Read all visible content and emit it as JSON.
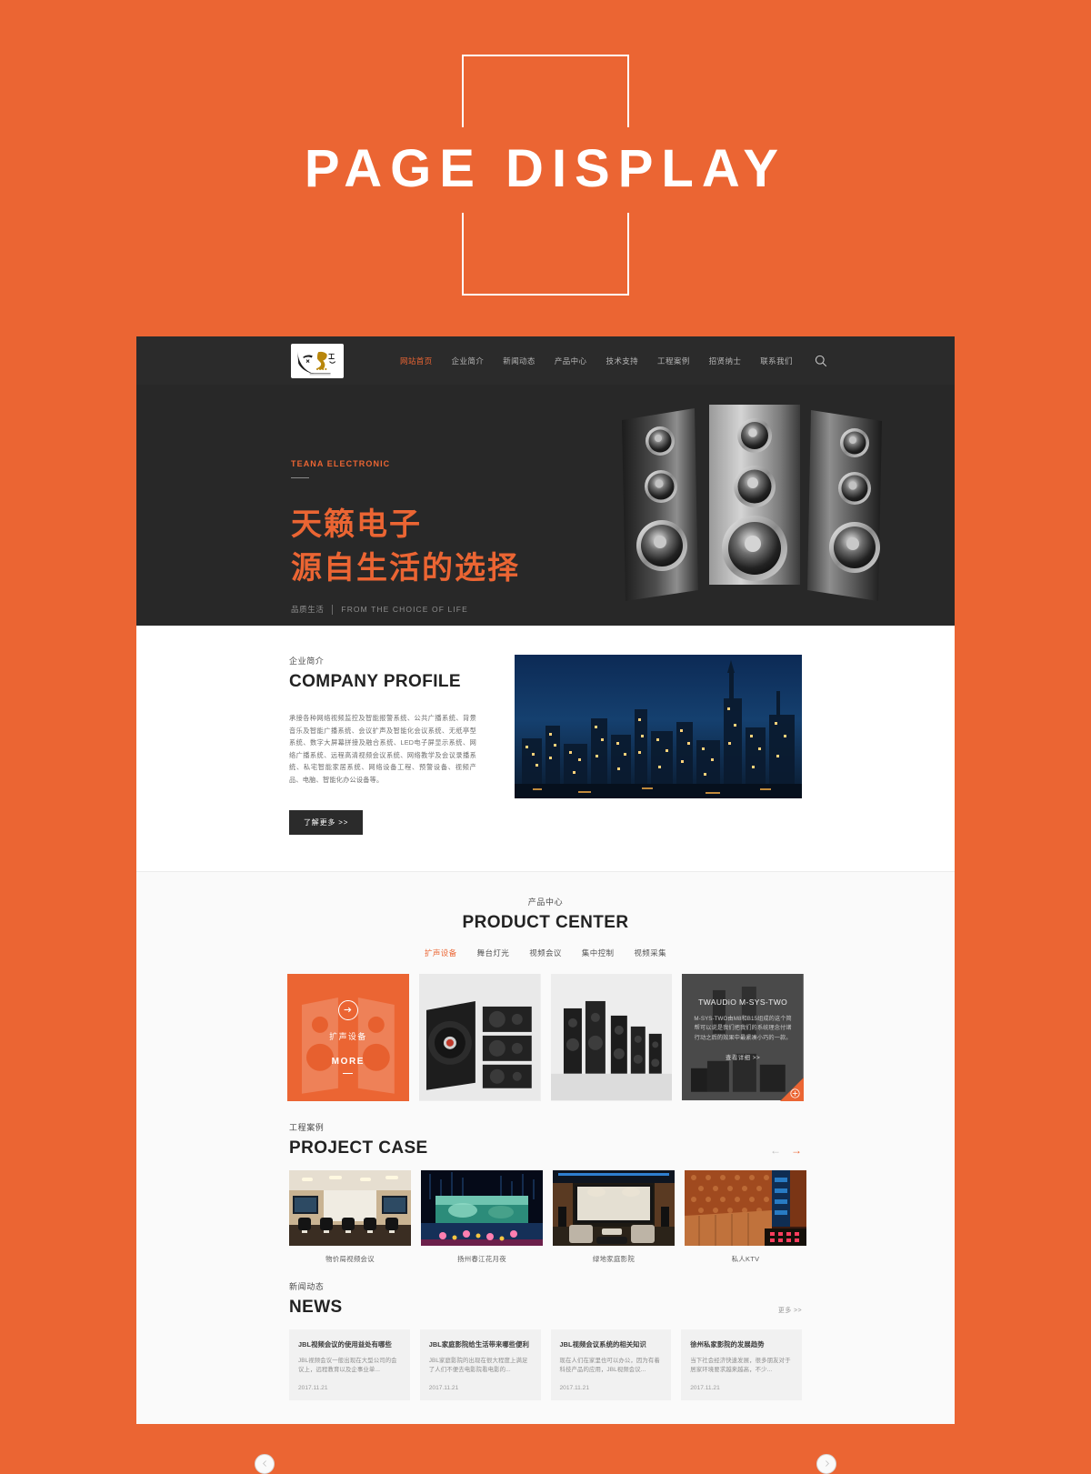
{
  "banner": {
    "title": "PAGE DISPLAY"
  },
  "site": {
    "nav": {
      "logo_alt": "Tianlai Electronic logo",
      "items": [
        {
          "label": "网站首页",
          "active": true
        },
        {
          "label": "企业简介",
          "active": false
        },
        {
          "label": "新闻动态",
          "active": false
        },
        {
          "label": "产品中心",
          "active": false
        },
        {
          "label": "技术支持",
          "active": false
        },
        {
          "label": "工程案例",
          "active": false
        },
        {
          "label": "招贤纳士",
          "active": false
        },
        {
          "label": "联系我们",
          "active": false
        }
      ],
      "search_icon": "search-icon"
    },
    "hero": {
      "eyebrow": "TEANA ELECTRONIC",
      "headline_line1": "天籁电子",
      "headline_line2": "源自生活的选择",
      "sub_zh": "品质生活",
      "sub_en": "FROM THE CHOICE OF LIFE",
      "image_alt": "three-speaker-towers"
    },
    "profile": {
      "section_zh": "企业简介",
      "section_en": "COMPANY PROFILE",
      "body": "承接各种网络视频监控及智能报警系统、公共广播系统、背景音乐及智能广播系统、会议扩声及智能化会议系统、无纸亭型系统、数字大屏幕拼接及融合系统、LED电子屏显示系统、网络广播系统、远程高清视频会议系统、网络教学及会议录播系统、私宅智能家居系统、网络设备工程、预警设备、视频产品、电脑、智能化办公设备等。",
      "more_label": "了解更多 >>",
      "photo_alt": "city-skyline-at-night"
    },
    "products": {
      "section_zh": "产品中心",
      "section_en": "PRODUCT CENTER",
      "tabs": [
        {
          "label": "扩声设备",
          "active": true
        },
        {
          "label": "舞台灯光",
          "active": false
        },
        {
          "label": "视频会议",
          "active": false
        },
        {
          "label": "集中控制",
          "active": false
        },
        {
          "label": "视频采集",
          "active": false
        }
      ],
      "cards": [
        {
          "type": "feature",
          "category": "扩声设备",
          "more_label": "MORE",
          "image_alt": "pa-speaker-pair"
        },
        {
          "type": "image",
          "image_alt": "black-subwoofer-and-line-array"
        },
        {
          "type": "image",
          "image_alt": "black-speaker-system-set"
        },
        {
          "type": "detail",
          "title": "TWAUDiO M-SYS-TWO",
          "desc": "M-SYS-TWO由M8和B15组成的这个简帮可以说是我们把我们的系统理念付诸行动之后的效果中最紧凑小巧的一款。",
          "link_label": "查看详细 >>",
          "image_alt": "twaudio-line-array-system"
        }
      ],
      "prev_icon": "chevron-left-icon",
      "next_icon": "chevron-right-icon"
    },
    "cases": {
      "section_zh": "工程案例",
      "section_en": "PROJECT CASE",
      "prev_icon": "arrow-left-icon",
      "next_icon": "arrow-right-icon",
      "items": [
        {
          "caption": "物价局视频会议",
          "image_alt": "conference-room-with-displays"
        },
        {
          "caption": "扬州春江花月夜",
          "image_alt": "stage-led-water-show"
        },
        {
          "caption": "绿地家庭影院",
          "image_alt": "home-theater-with-projection-screen"
        },
        {
          "caption": "私人KTV",
          "image_alt": "private-ktv-lounge"
        }
      ]
    },
    "news": {
      "section_zh": "新闻动态",
      "section_en": "NEWS",
      "more_label": "更多 >>",
      "items": [
        {
          "title": "JBL视频会议的使用益处有哪些",
          "desc": "JBL视频会议一般出现在大型公司的会议上，远程教育以及企事业单...",
          "date": "2017.11.21"
        },
        {
          "title": "JBL家庭影院给生活带来哪些便利",
          "desc": "JBL家庭影院的出现在很大程度上满足了人们不便去电影院看电影的...",
          "date": "2017.11.21"
        },
        {
          "title": "JBL视频会议系统的相关知识",
          "desc": "现在人们在家里也可以办公，因为有着科技产品的应用，JBL视频会议...",
          "date": "2017.11.21"
        },
        {
          "title": "徐州私家影院的发展趋势",
          "desc": "当下社会经济快速发展，很多朋友对于居家环境要求越来越高，不少...",
          "date": "2017.11.21"
        }
      ]
    }
  },
  "colors": {
    "brand_orange": "#eb6533",
    "dark": "#2b2b2b",
    "hero_dark": "#282828"
  }
}
